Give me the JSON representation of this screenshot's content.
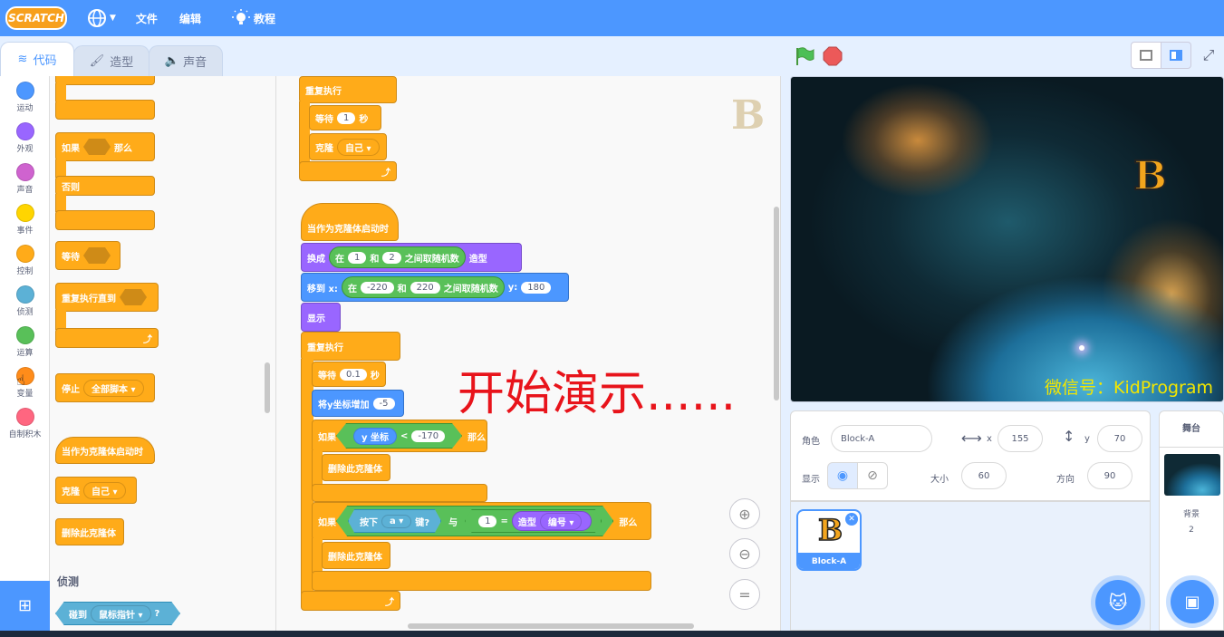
{
  "menubar": {
    "logo": "SCRATCH",
    "file": "文件",
    "edit": "编辑",
    "tutorials": "教程"
  },
  "tabs": {
    "code": "代码",
    "costumes": "造型",
    "sounds": "声音"
  },
  "categories": [
    {
      "label": "运动",
      "color": "#4c97ff"
    },
    {
      "label": "外观",
      "color": "#9966ff"
    },
    {
      "label": "声音",
      "color": "#cf63cf"
    },
    {
      "label": "事件",
      "color": "#ffd500"
    },
    {
      "label": "控制",
      "color": "#ffab19"
    },
    {
      "label": "侦测",
      "color": "#5cb1d6"
    },
    {
      "label": "运算",
      "color": "#59c059"
    },
    {
      "label": "变量",
      "color": "#ff8c1a"
    },
    {
      "label": "自制积木",
      "color": "#ff6680"
    }
  ],
  "palette": {
    "if_label": "如果",
    "then_label": "那么",
    "else_label": "否则",
    "wait_label": "等待",
    "repeat_until_label": "重复执行直到",
    "stop_label": "停止",
    "stop_option": "全部脚本",
    "clone_start": "当作为克隆体启动时",
    "clone_label": "克隆",
    "clone_option": "自己",
    "delete_clone": "删除此克隆体",
    "sensing_heading": "侦测",
    "touching_label": "碰到",
    "touching_option": "鼠标指针",
    "question_mark": "?"
  },
  "script1": {
    "forever": "重复执行",
    "wait": "等待",
    "wait_value": "1",
    "sec": "秒",
    "clone": "克隆",
    "clone_option": "自己"
  },
  "script2": {
    "hat": "当作为克隆体启动时",
    "switch_costume": "换成",
    "costume_suffix": "造型",
    "random_in": "在",
    "random_and": "和",
    "random_suffix": "之间取随机数",
    "costume_min": "1",
    "costume_max": "2",
    "goto_label": "移到 x:",
    "x_min": "-220",
    "x_max": "220",
    "y_label": "y:",
    "y_value": "180",
    "show": "显示",
    "forever": "重复执行",
    "wait": "等待",
    "wait_value": "0.1",
    "sec": "秒",
    "change_y": "将y坐标增加",
    "change_y_value": "-5",
    "if1": "如果",
    "y_pos": "y 坐标",
    "lt": "<",
    "lt_value": "-170",
    "then": "那么",
    "delete_clone": "删除此克隆体",
    "if2": "如果",
    "key_pressed": "按下",
    "key": "a",
    "key_suffix": "键?",
    "and": "与",
    "eq_left": "1",
    "eq": "=",
    "costume": "造型",
    "costume_attr": "编号",
    "then2": "那么",
    "delete_clone2": "删除此克隆体"
  },
  "overlay_text": "开始演示......",
  "watermark": "微信号：KidProgram",
  "sprite_info": {
    "sprite_label": "角色",
    "sprite_name": "Block-A",
    "x_label": "x",
    "x_value": "155",
    "y_label": "y",
    "y_value": "70",
    "show_label": "显示",
    "size_label": "大小",
    "size_value": "60",
    "direction_label": "方向",
    "direction_value": "90"
  },
  "sprite_list": [
    {
      "name": "Block-A",
      "letter": "B"
    }
  ],
  "stage_panel": {
    "title": "舞台",
    "backdrop_label": "背景",
    "backdrop_count": "2"
  },
  "stage_sprite_letter": "B",
  "costume_letter": "B"
}
